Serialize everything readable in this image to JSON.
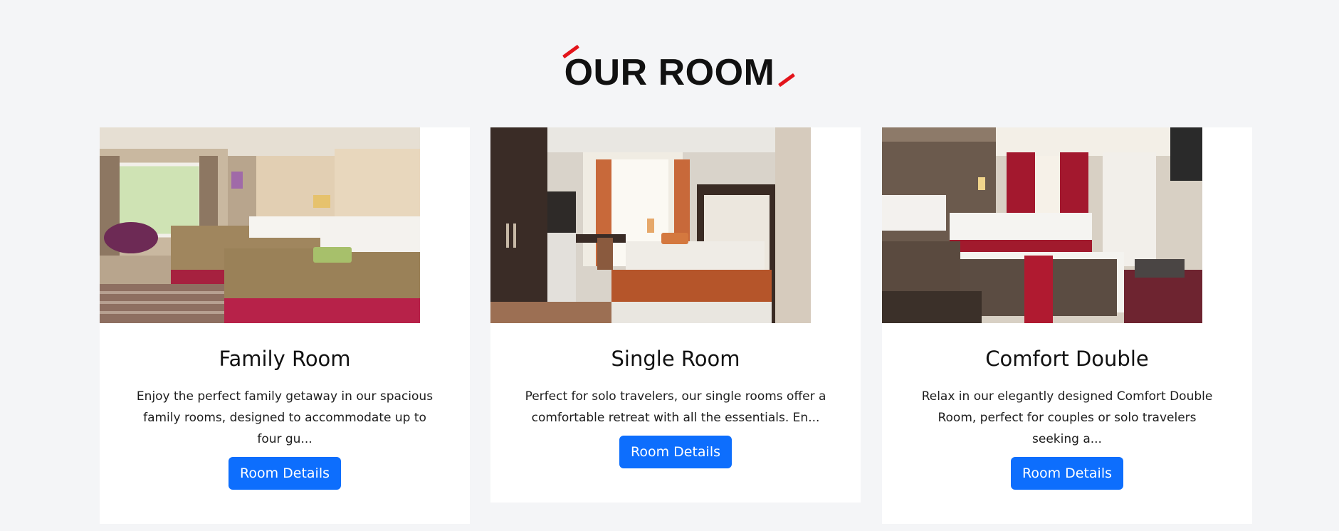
{
  "section": {
    "title": "OUR ROOM"
  },
  "colors": {
    "accent": "#e3141b",
    "button": "#0d6efd",
    "background": "#f4f5f7"
  },
  "rooms": [
    {
      "title": "Family Room",
      "description": "Enjoy the perfect family getaway in our spacious family rooms, designed to accommodate up to four gu...",
      "button_label": "Room Details"
    },
    {
      "title": "Single Room",
      "description": "Perfect for solo travelers, our single rooms offer a comfortable retreat with all the essentials. En...",
      "button_label": "Room Details"
    },
    {
      "title": "Comfort Double",
      "description": "Relax in our elegantly designed Comfort Double Room, perfect for couples or solo travelers seeking a...",
      "button_label": "Room Details"
    }
  ]
}
